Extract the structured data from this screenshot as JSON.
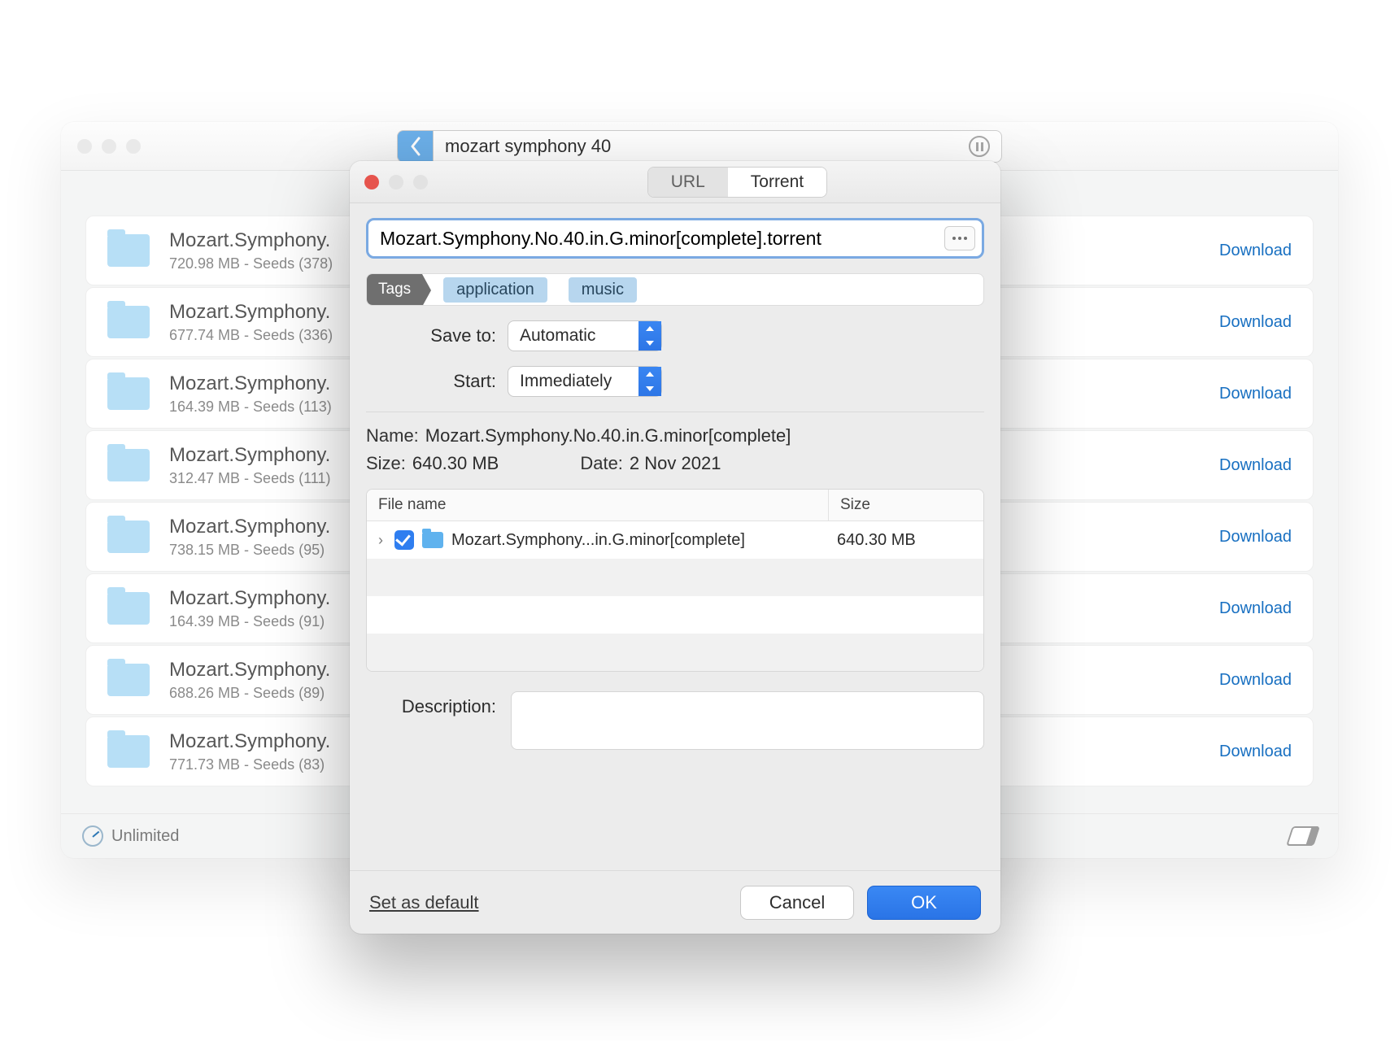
{
  "parent": {
    "search_value": "mozart symphony 40",
    "download_label": "Download",
    "footer_label": "Unlimited",
    "results": [
      {
        "title": "Mozart.Symphony.",
        "size": "720.98 MB",
        "seeds": "378"
      },
      {
        "title": "Mozart.Symphony.",
        "size": "677.74 MB",
        "seeds": "336"
      },
      {
        "title": "Mozart.Symphony.",
        "size": "164.39 MB",
        "seeds": "113"
      },
      {
        "title": "Mozart.Symphony.",
        "size": "312.47 MB",
        "seeds": "111"
      },
      {
        "title": "Mozart.Symphony.",
        "size": "738.15 MB",
        "seeds": "95"
      },
      {
        "title": "Mozart.Symphony.",
        "size": "164.39 MB",
        "seeds": "91"
      },
      {
        "title": "Mozart.Symphony.",
        "size": "688.26 MB",
        "seeds": "89"
      },
      {
        "title": "Mozart.Symphony.",
        "size": "771.73 MB",
        "seeds": "83"
      }
    ]
  },
  "dialog": {
    "tabs": {
      "url": "URL",
      "torrent": "Torrent"
    },
    "url_value": "Mozart.Symphony.No.40.in.G.minor[complete].torrent",
    "tags_label": "Tags",
    "tags": [
      "application",
      "music"
    ],
    "save_to_label": "Save to:",
    "save_to_value": "Automatic",
    "start_label": "Start:",
    "start_value": "Immediately",
    "meta": {
      "name_k": "Name:",
      "name_v": "Mozart.Symphony.No.40.in.G.minor[complete]",
      "size_k": "Size:",
      "size_v": "640.30 MB",
      "date_k": "Date:",
      "date_v": "2 Nov 2021"
    },
    "file_table": {
      "col_name": "File name",
      "col_size": "Size",
      "row": {
        "name": "Mozart.Symphony...in.G.minor[complete]",
        "size": "640.30 MB"
      }
    },
    "description_label": "Description:",
    "set_default": "Set as default",
    "cancel": "Cancel",
    "ok": "OK"
  }
}
